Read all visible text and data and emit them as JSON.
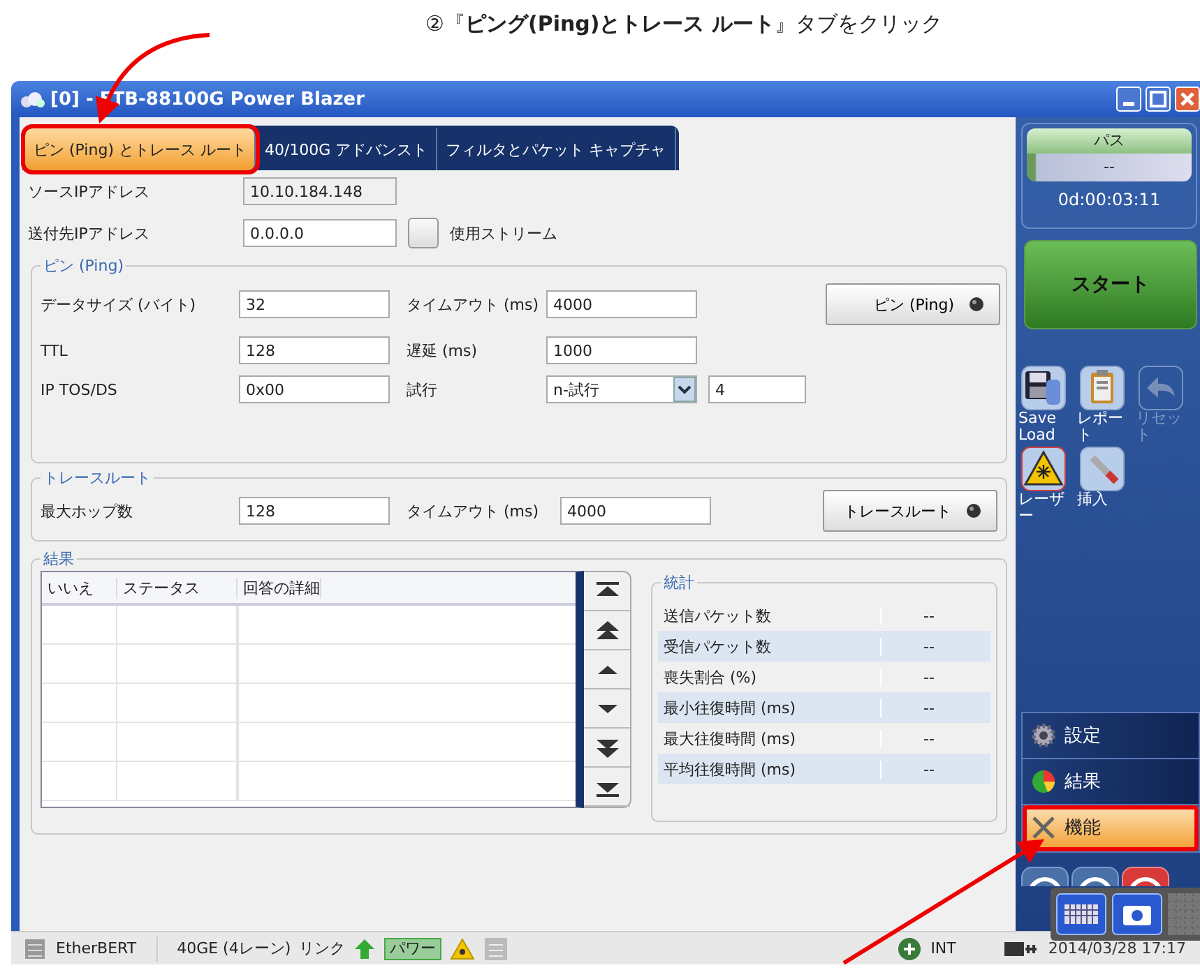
{
  "annotation": {
    "text": "②『**ピング(Ping)とトレース ルート**』タブをクリック"
  },
  "window": {
    "title": "[0] - FTB-88100G Power Blazer"
  },
  "tabs": [
    {
      "label": "ピン (Ping) とトレース ルート",
      "selected": true,
      "callout": true
    },
    {
      "label": "40/100G アドバンスト",
      "selected": false,
      "callout": false
    },
    {
      "label": "フィルタとパケット キャプチャ",
      "selected": false,
      "callout": false
    }
  ],
  "addresses": {
    "source_label": "ソースIPアドレス",
    "source_value": "10.10.184.148",
    "dest_label": "送付先IPアドレス",
    "dest_value": "0.0.0.0",
    "stream_label": "使用ストリーム",
    "stream_checked": false
  },
  "ping": {
    "title": "ピン (Ping)",
    "button": "ピン (Ping)",
    "led_on": false,
    "rows": [
      {
        "label": "データサイズ (バイト)",
        "value": "32",
        "label_2": "タイムアウト (ms)",
        "value_2": "4000"
      },
      {
        "label": "TTL",
        "value": "128",
        "label_2": "遅延 (ms)",
        "value_2": "1000"
      },
      {
        "label": "IP TOS/DS",
        "value": "0x00",
        "label_2": "試行",
        "select": "n-試行",
        "value_2": "4"
      }
    ]
  },
  "traceroute": {
    "title": "トレースルート",
    "button": "トレースルート",
    "led_on": false,
    "label": "最大ホップ数",
    "value": "128",
    "label_2": "タイムアウト (ms)",
    "value_2": "4000"
  },
  "results": {
    "title": "結果",
    "columns": [
      "いいえ",
      "ステータス",
      "回答の詳細"
    ]
  },
  "stats": {
    "title": "統計",
    "rows": [
      {
        "label": "送信パケット数",
        "value": "--"
      },
      {
        "label": "受信パケット数",
        "value": "--"
      },
      {
        "label": "喪失割合 (%)",
        "value": "--"
      },
      {
        "label": "最小往復時間 (ms)",
        "value": "--"
      },
      {
        "label": "最大往復時間 (ms)",
        "value": "--"
      },
      {
        "label": "平均往復時間 (ms)",
        "value": "--"
      }
    ]
  },
  "side": {
    "status_label": "パス",
    "status_value": "--",
    "timer": "0d:00:03:11",
    "start": "スタート",
    "tools": [
      {
        "kind": "save",
        "label": "Save Load",
        "disabled": false
      },
      {
        "kind": "report",
        "label": "レポート",
        "disabled": false
      },
      {
        "kind": "reset",
        "label": "リセット",
        "disabled": true
      },
      {
        "kind": "laser",
        "label": "レーザー",
        "disabled": false
      },
      {
        "kind": "insert",
        "label": "挿入",
        "disabled": false
      }
    ],
    "nav": [
      {
        "kind": "gear",
        "label": "設定",
        "selected": false,
        "callout": false
      },
      {
        "kind": "pie",
        "label": "結果",
        "selected": false,
        "callout": false
      },
      {
        "kind": "tools",
        "label": "機能",
        "selected": true,
        "callout": true
      }
    ]
  },
  "status_bar": {
    "module": "EtherBERT",
    "interface": "40GE (4レーン)",
    "link": "リンク",
    "power": "パワー",
    "clock": "INT",
    "datetime": "2014/03/28 17:17"
  }
}
